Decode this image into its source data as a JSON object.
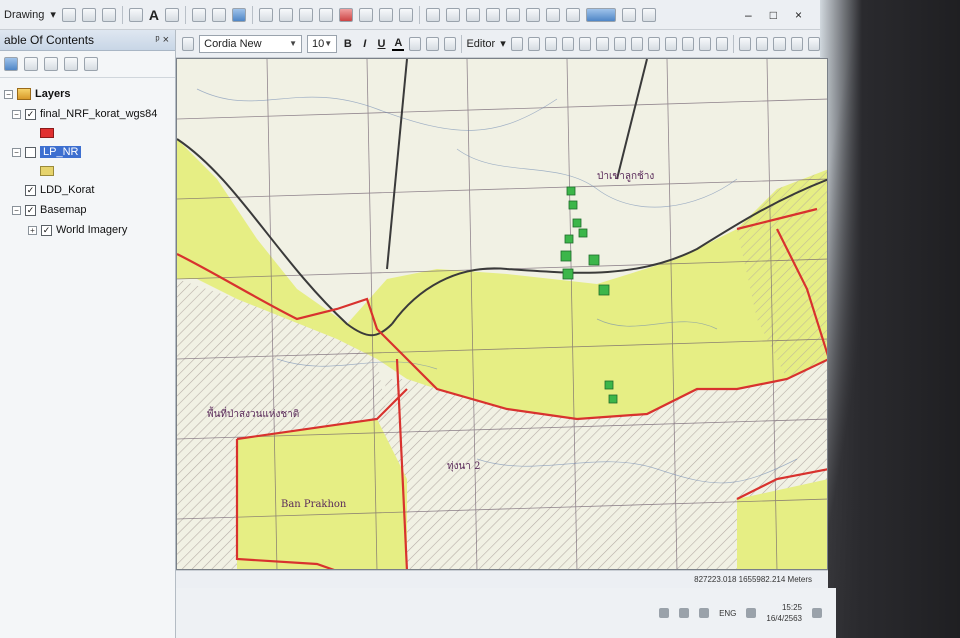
{
  "toolbar": {
    "drawing_label": "Drawing",
    "drawing_arrow": "▾",
    "text_tool": "A",
    "editor_label": "Editor",
    "editor_arrow": "▾",
    "font_name": "Cordia New",
    "font_size": "10",
    "bold": "B",
    "italic": "I",
    "underline": "U",
    "font_color": "A"
  },
  "window_controls": {
    "minimize": "–",
    "maximize": "□",
    "close": "×"
  },
  "toc": {
    "title": "able Of Contents",
    "pin": "ᵖ ×",
    "layers_root": "Layers",
    "items": [
      {
        "label": "final_NRF_korat_wgs84",
        "checked": true,
        "expanded": true,
        "symbol": "red"
      },
      {
        "label": "LP_NR",
        "checked": false,
        "expanded": true,
        "symbol": "yellow",
        "selected": true
      },
      {
        "label": "LDD_Korat",
        "checked": true
      },
      {
        "label": "Basemap",
        "checked": true,
        "expanded": true
      },
      {
        "label": "World Imagery",
        "checked": true,
        "child": true
      }
    ]
  },
  "map": {
    "labels": [
      "Ban Prakhon",
      "พื้นที่ป่าสงวนแห่งชาติ",
      "ป่าเขาลูกช้าง",
      "ทุ่งนา 2"
    ],
    "colors": {
      "fill_yellow": "#e6ee84",
      "boundary_red": "#d8322e",
      "road_dark": "#3a3a3a",
      "point_green": "#3cb64a"
    }
  },
  "status": {
    "coordinates": "827223.018  1655982.214 Meters"
  },
  "taskbar": {
    "lang": "ENG",
    "time": "15:25",
    "date": "16/4/2563"
  }
}
